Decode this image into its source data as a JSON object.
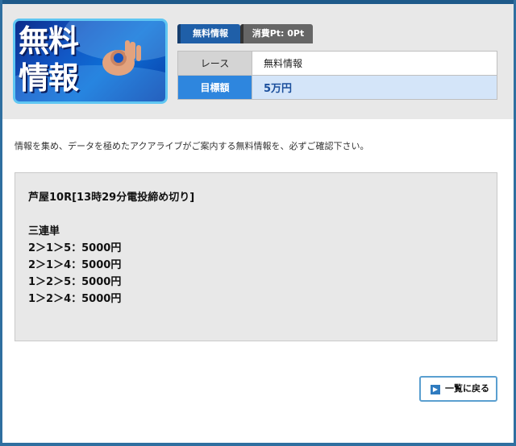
{
  "header": {
    "logo_text": [
      "無料",
      "情報"
    ],
    "tabs": [
      {
        "label": "無料情報"
      },
      {
        "label": "消費Pt: 0Pt"
      }
    ],
    "info": {
      "race_label": "レース",
      "race_value": "無料情報",
      "target_label": "目標額",
      "target_value": "5万円"
    }
  },
  "intro_text": "情報を集め、データを極めたアクアライブがご案内する無料情報を、必ずご確認下さい。",
  "content": {
    "race_title": "芦屋10R[13時29分電投締め切り]",
    "bet_type": "三連単",
    "bets": [
      "2＞1＞5：5000円",
      "2＞1＞4：5000円",
      "1＞2＞5：5000円",
      "1＞2＞4：5000円"
    ]
  },
  "back_button": {
    "label": "一覧に戻る"
  },
  "colors": {
    "accent": "#2e86de",
    "frame": "#2f6fa0",
    "tab_free": "#1f5fa8",
    "tab_pt": "#666666"
  }
}
